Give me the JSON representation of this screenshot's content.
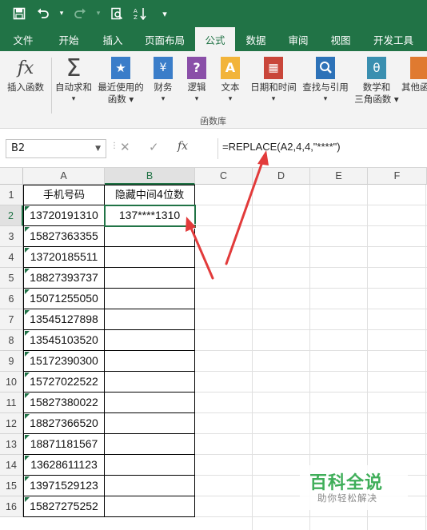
{
  "qat": {
    "icons": [
      "save-icon",
      "undo-icon",
      "redo-icon",
      "print-preview-icon",
      "sort-icon",
      "customize-qat-icon"
    ]
  },
  "ribbon_tabs": [
    {
      "label": "文件",
      "active": false
    },
    {
      "label": "开始",
      "active": false
    },
    {
      "label": "插入",
      "active": false
    },
    {
      "label": "页面布局",
      "active": false
    },
    {
      "label": "公式",
      "active": true
    },
    {
      "label": "数据",
      "active": false
    },
    {
      "label": "审阅",
      "active": false
    },
    {
      "label": "视图",
      "active": false
    },
    {
      "label": "开发工具",
      "active": false
    }
  ],
  "ribbon": {
    "buttons": [
      {
        "label": "插入函数",
        "label2": "",
        "icon": "insert-function-icon",
        "glyph": "fx"
      },
      {
        "label": "自动求和",
        "label2": "",
        "icon": "autosum-icon",
        "glyph": "Σ"
      },
      {
        "label": "最近使用的",
        "label2": "函数",
        "icon": "recent-functions-icon",
        "glyph": "★"
      },
      {
        "label": "财务",
        "label2": "",
        "icon": "financial-icon",
        "glyph": "¥"
      },
      {
        "label": "逻辑",
        "label2": "",
        "icon": "logical-icon",
        "glyph": "?"
      },
      {
        "label": "文本",
        "label2": "",
        "icon": "text-icon",
        "glyph": "A"
      },
      {
        "label": "日期和时间",
        "label2": "",
        "icon": "date-time-icon",
        "glyph": "▦"
      },
      {
        "label": "查找与引用",
        "label2": "",
        "icon": "lookup-reference-icon",
        "glyph": "🔍"
      },
      {
        "label": "数学和",
        "label2": "三角函数",
        "icon": "math-trig-icon",
        "glyph": "θ"
      },
      {
        "label": "其他函",
        "label2": "",
        "icon": "more-functions-icon",
        "glyph": "…"
      }
    ],
    "group_label": "函数库"
  },
  "formula_bar": {
    "name_box": "B2",
    "cancel_symbol": "✕",
    "enter_symbol": "✓",
    "fx_symbol": "fx",
    "formula": "=REPLACE(A2,4,4,\"****\")"
  },
  "columns": [
    "A",
    "B",
    "C",
    "D",
    "E",
    "F"
  ],
  "rows": [
    "1",
    "2",
    "3",
    "4",
    "5",
    "6",
    "7",
    "8",
    "9",
    "10",
    "11",
    "12",
    "13",
    "14",
    "15",
    "16"
  ],
  "sheet": {
    "header_a": "手机号码",
    "header_b": "隐藏中间4位数",
    "phone_numbers": [
      "13720191310",
      "15827363355",
      "13720185511",
      "18827393737",
      "15071255050",
      "13545127898",
      "13545103520",
      "15172390300",
      "15727022522",
      "15827380022",
      "18827366520",
      "18871181567",
      "13628611123",
      "13971529123",
      "15827275252"
    ],
    "result_b2": "137****1310"
  },
  "selected_cell": "B2",
  "watermark": {
    "title": "百科全说",
    "subtitle": "助你轻松解决"
  },
  "colors": {
    "excel_green": "#217346",
    "annotation_red": "#e23b3b",
    "watermark_green": "#3fae59"
  }
}
